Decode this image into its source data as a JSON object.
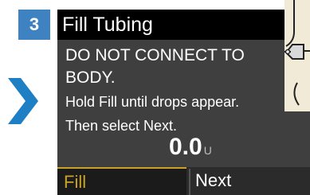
{
  "step": {
    "number": "3"
  },
  "navigation": {
    "arrow_icon": "chevron-right-icon",
    "arrow_color": "#1f7fc4"
  },
  "screen": {
    "title": "Fill Tubing",
    "warning_line_1": "DO NOT CONNECT TO",
    "warning_line_2": "BODY.",
    "instruction_line_1": "Hold Fill until drops appear.",
    "instruction_line_2": "Then select Next.",
    "amount_value": "0.0",
    "amount_unit": "U"
  },
  "softkeys": {
    "left_label": "Fill",
    "right_label": "Next"
  },
  "illustration": {
    "icon": "tubing-connector-icon"
  },
  "colors": {
    "step_badge": "#3f82c1",
    "screen_background": "#3f3f3f",
    "header_background": "#000000",
    "fill_softkey_text": "#c9a227"
  }
}
